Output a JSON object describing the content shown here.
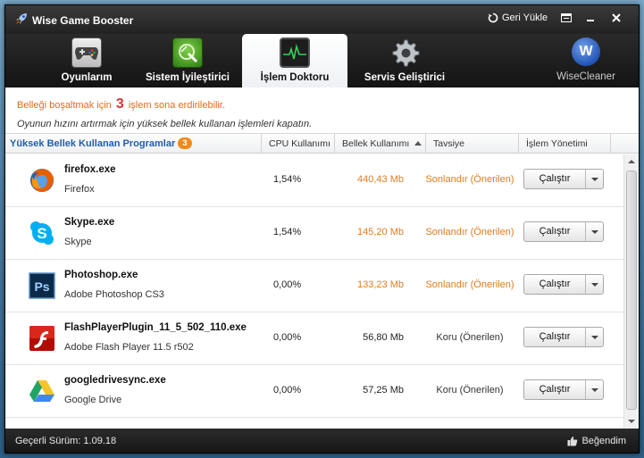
{
  "window": {
    "title": "Wise Game Booster",
    "restore_label": "Geri Yükle",
    "menu_icon": "menu-icon",
    "minimize_icon": "minimize-icon",
    "close_icon": "close-icon"
  },
  "nav": {
    "tabs": [
      {
        "label": "Oyunlarım",
        "icon": "gamepad-icon",
        "active": false
      },
      {
        "label": "Sistem İyileştirici",
        "icon": "wand-icon",
        "active": false
      },
      {
        "label": "İşlem Doktoru",
        "icon": "pulse-monitor-icon",
        "active": true
      },
      {
        "label": "Servis Geliştirici",
        "icon": "gear-icon",
        "active": false
      }
    ],
    "brand": {
      "letter": "W",
      "label": "WiseCleaner"
    }
  },
  "info": {
    "line1_before": "Belleği boşaltmak için",
    "line1_count": "3",
    "line1_after": "işlem sona erdirilebilir.",
    "line2": "Oyunun hızını artırmak için yüksek bellek kullanan işlemleri kapatın."
  },
  "table": {
    "headers": {
      "programs": "Yüksek Bellek Kullanan Programlar",
      "programs_badge": "3",
      "cpu": "CPU Kullanımı",
      "memory": "Bellek Kullanımı",
      "advice": "Tavsiye",
      "management": "İşlem Yönetimi"
    },
    "rows": [
      {
        "name": "firefox.exe",
        "desc": "Firefox",
        "cpu": "1,54%",
        "mem": "440,43 Mb",
        "mem_high": true,
        "advice": "Sonlandır (Önerilen)",
        "advice_kind": "kill",
        "button": "Çalıştır",
        "icon": "firefox-icon"
      },
      {
        "name": "Skype.exe",
        "desc": "Skype",
        "cpu": "1,54%",
        "mem": "145,20 Mb",
        "mem_high": true,
        "advice": "Sonlandır (Önerilen)",
        "advice_kind": "kill",
        "button": "Çalıştır",
        "icon": "skype-icon"
      },
      {
        "name": "Photoshop.exe",
        "desc": "Adobe Photoshop CS3",
        "cpu": "0,00%",
        "mem": "133,23 Mb",
        "mem_high": true,
        "advice": "Sonlandır (Önerilen)",
        "advice_kind": "kill",
        "button": "Çalıştır",
        "icon": "photoshop-icon"
      },
      {
        "name": "FlashPlayerPlugin_11_5_502_110.exe",
        "desc": "Adobe Flash Player 11.5 r502",
        "cpu": "0,00%",
        "mem": "56,80 Mb",
        "mem_high": false,
        "advice": "Koru (Önerilen)",
        "advice_kind": "keep",
        "button": "Çalıştır",
        "icon": "flash-player-icon"
      },
      {
        "name": "googledrivesync.exe",
        "desc": "Google Drive",
        "cpu": "0,00%",
        "mem": "57,25 Mb",
        "mem_high": false,
        "advice": "Koru (Önerilen)",
        "advice_kind": "keep",
        "button": "Çalıştır",
        "icon": "google-drive-icon"
      }
    ]
  },
  "status": {
    "version": "Geçerli Sürüm: 1.09.18",
    "like_label": "Beğendim"
  }
}
